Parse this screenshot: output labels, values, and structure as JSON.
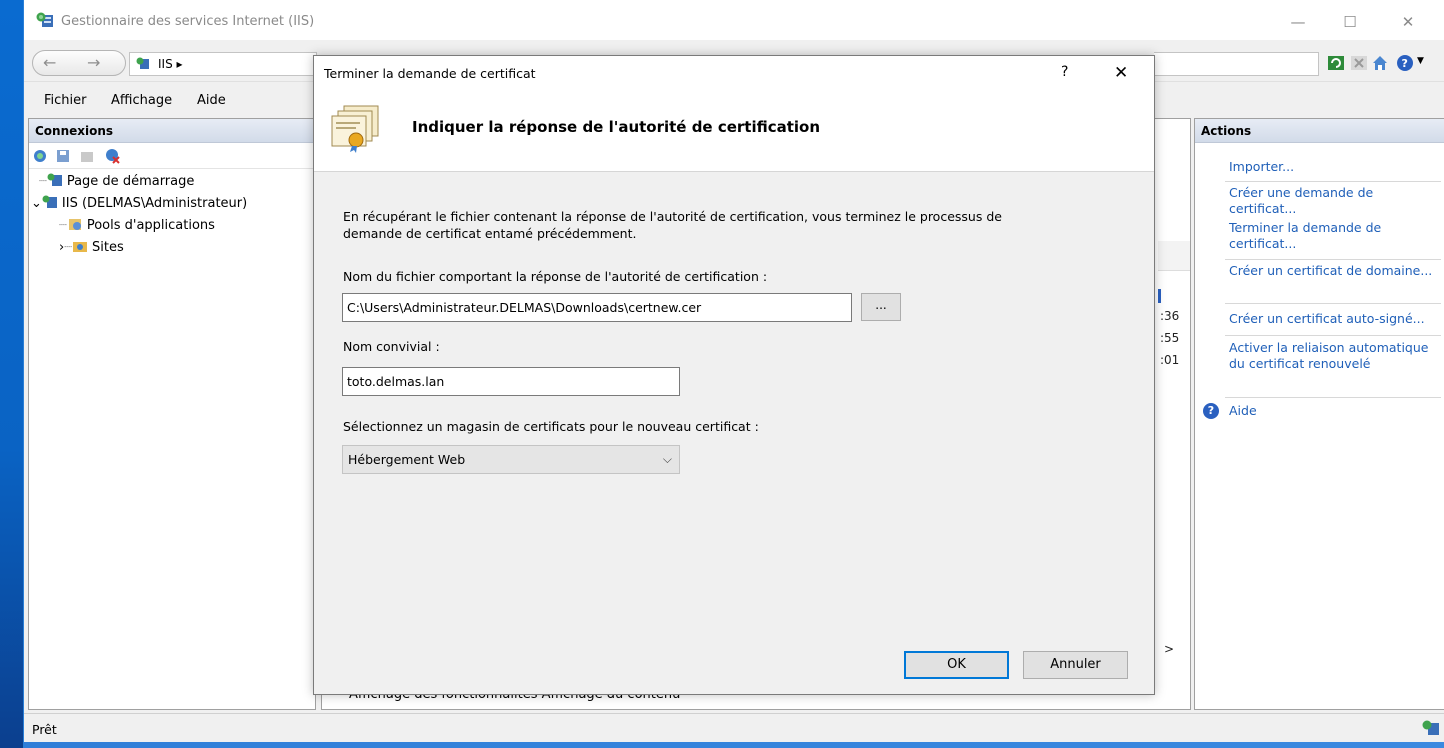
{
  "window": {
    "title": "Gestionnaire des services Internet (IIS)",
    "minimize": "—",
    "maximize": "☐",
    "close": "✕"
  },
  "addressbar": {
    "back": "←",
    "forward": "→",
    "crumb": "IIS  ▸",
    "crumb_arrow": "▸"
  },
  "menu": {
    "file": "Fichier",
    "view": "Affichage",
    "help": "Aide"
  },
  "connections": {
    "header": "Connexions",
    "tree": [
      {
        "label": "Page de démarrage",
        "icon": "iis-server-icon"
      },
      {
        "label": "IIS (DELMAS\\Administrateur)",
        "icon": "iis-server-icon",
        "expander": "⌄"
      },
      {
        "label": "Pools d'applications",
        "icon": "app-pool-icon"
      },
      {
        "label": "Sites",
        "icon": "sites-folder-icon",
        "expander": "›"
      }
    ]
  },
  "middle": {
    "fragments": [
      ":36",
      ":55",
      ":01"
    ],
    "scroll_arrow": ">",
    "view_tabs": "Affichage des fonctionnalités    Affichage du contenu"
  },
  "actions": {
    "header": "Actions",
    "items": [
      "Importer...",
      "Créer une demande de certificat...",
      "Terminer la demande de certificat...",
      "Créer un certificat de domaine...",
      "Créer un certificat auto-signé...",
      "Activer la reliaison automatique du certificat renouvelé"
    ],
    "help": "Aide"
  },
  "status": {
    "text": "Prêt"
  },
  "dialog": {
    "title": "Terminer la demande de certificat",
    "help_glyph": "?",
    "close_glyph": "✕",
    "heading": "Indiquer la réponse de l'autorité de certification",
    "intro_line1": "En récupérant le fichier contenant la réponse de l'autorité de certification, vous terminez le processus de",
    "intro_line2": "demande de certificat entamé précédemment.",
    "file_label": "Nom du fichier comportant la réponse de l'autorité de certification :",
    "file_value": "C:\\Users\\Administrateur.DELMAS\\Downloads\\certnew.cer",
    "browse_label": "...",
    "friendly_label": "Nom convivial :",
    "friendly_value": "toto.delmas.lan",
    "store_label": "Sélectionnez un magasin de certificats pour le nouveau certificat :",
    "store_value": "Hébergement Web",
    "ok": "OK",
    "cancel": "Annuler"
  },
  "colors": {
    "link": "#1f5fb8",
    "accent": "#0078d7",
    "header_gradient_top": "#e7ecf5"
  }
}
